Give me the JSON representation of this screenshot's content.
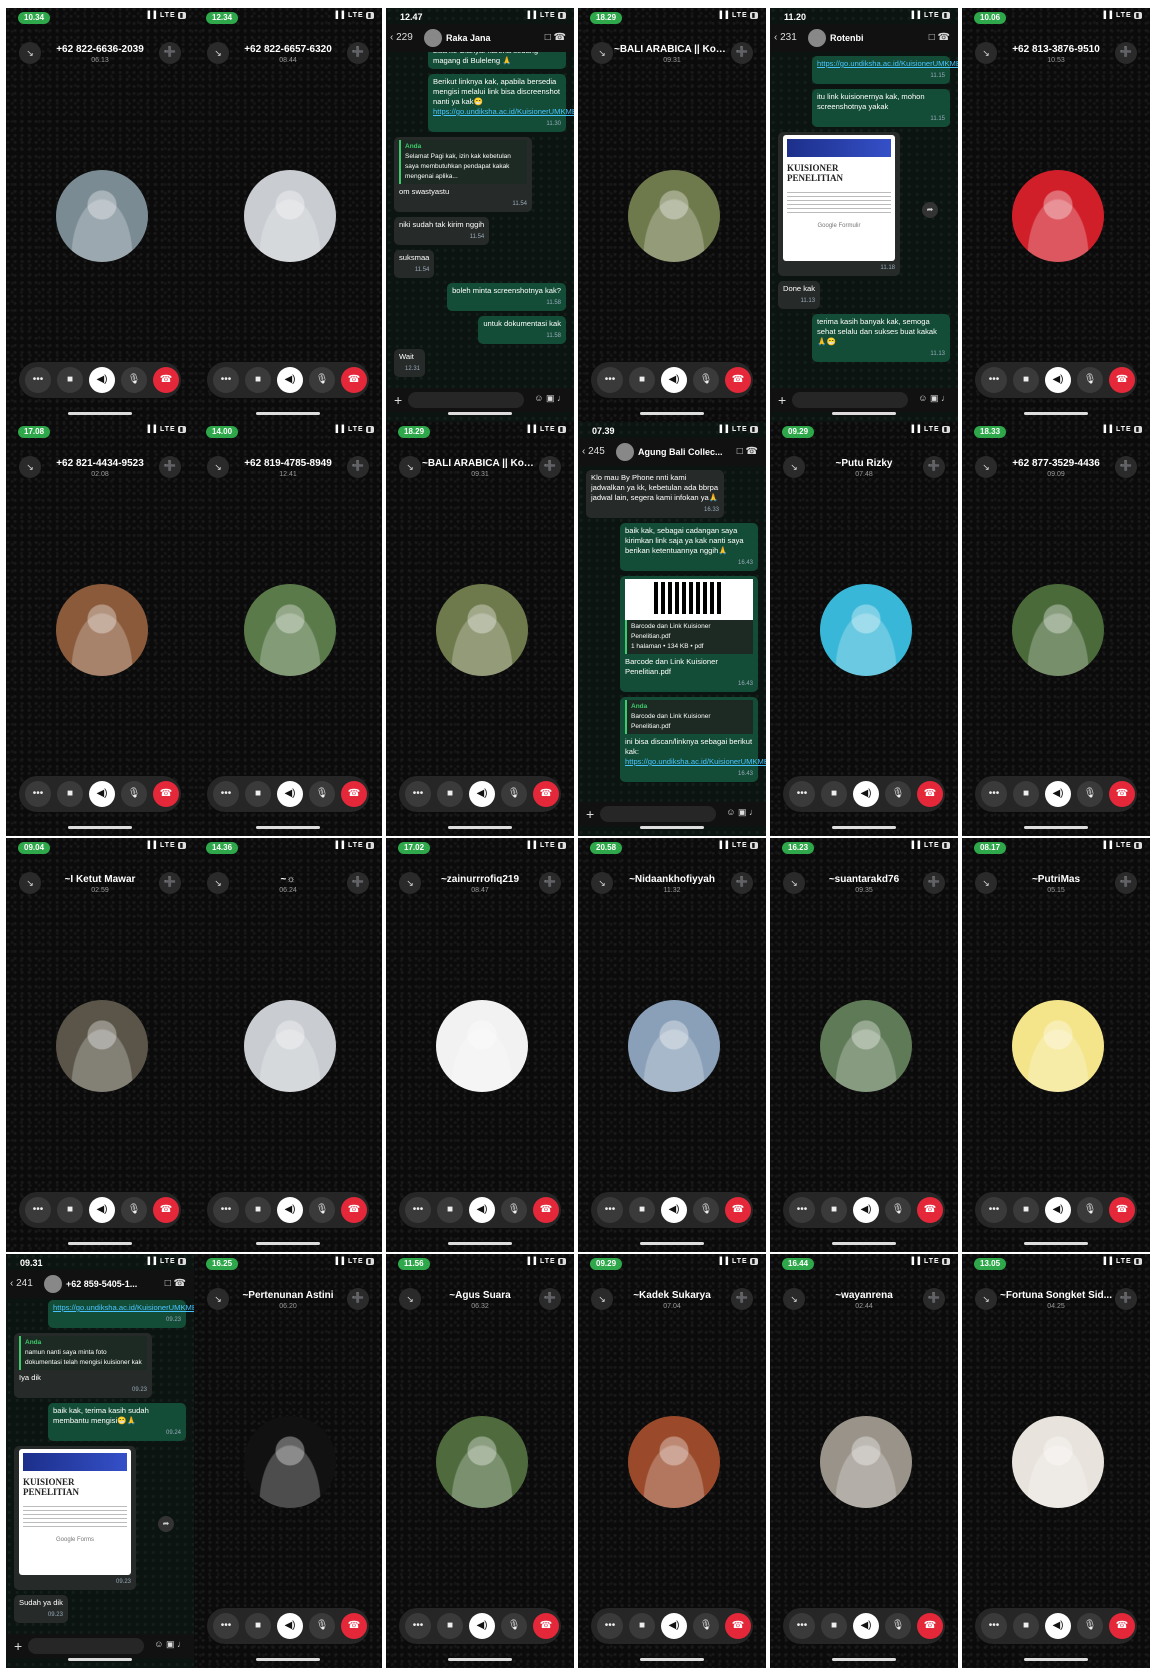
{
  "controls": {
    "more": "•••",
    "video": "■",
    "speaker": "◀)",
    "mute": "🎙",
    "end": "☎",
    "minimize": "↘",
    "add_person": "➕"
  },
  "calls": [
    {
      "time": "10.34",
      "name": "+62 822-6636-2039",
      "duration": "06.13",
      "avatar_color": "#7a8b94"
    },
    {
      "time": "12.34",
      "name": "+62 822-6657-6320",
      "duration": "08.44",
      "avatar_color": "#c9ccd1"
    },
    {
      "time": "18.29",
      "name": "~BALI ARABICA || Kopi...",
      "duration": "09.31",
      "avatar_color": "#6f7a4c"
    },
    {
      "time": "10.06",
      "name": "+62 813-3876-9510",
      "duration": "10.53",
      "avatar_color": "#d11f2a"
    },
    {
      "time": "17.08",
      "name": "+62 821-4434-9523",
      "duration": "02.08",
      "avatar_color": "#8a5a3a"
    },
    {
      "time": "14.00",
      "name": "+62 819-4785-8949",
      "duration": "12.41",
      "avatar_color": "#5a7a4a"
    },
    {
      "time": "18.29",
      "name": "~BALI ARABICA || Kopi...",
      "duration": "09.31",
      "avatar_color": "#6f7a4c"
    },
    {
      "time": "09.29",
      "name": "~Putu Rizky",
      "duration": "07.48",
      "avatar_color": "#39b7d8"
    },
    {
      "time": "18.33",
      "name": "+62 877-3529-4436",
      "duration": "09.09",
      "avatar_color": "#4a6a3a"
    },
    {
      "time": "09.04",
      "name": "~I Ketut Mawar",
      "duration": "02.59",
      "avatar_color": "#5a5548"
    },
    {
      "time": "14.36",
      "name": "~☼",
      "duration": "06.24",
      "avatar_color": "#c9ccd1"
    },
    {
      "time": "17.02",
      "name": "~zainurrrofiq219",
      "duration": "08.47",
      "avatar_color": "#f2f2f2"
    },
    {
      "time": "20.58",
      "name": "~Nidaankhofiyyah",
      "duration": "11.32",
      "avatar_color": "#8aa0b8"
    },
    {
      "time": "16.23",
      "name": "~suantarakd76",
      "duration": "09.35",
      "avatar_color": "#5f7a56"
    },
    {
      "time": "08.17",
      "name": "~PutriMas",
      "duration": "05.15",
      "avatar_color": "#f4e58a"
    },
    {
      "time": "16.25",
      "name": "~Pertenunan Astini",
      "duration": "06.20",
      "avatar_color": "#111111"
    },
    {
      "time": "11.56",
      "name": "~Agus Suara",
      "duration": "06.32",
      "avatar_color": "#4f6b3e"
    },
    {
      "time": "09.29",
      "name": "~Kadek Sukarya",
      "duration": "07.04",
      "avatar_color": "#9a4a2a"
    },
    {
      "time": "16.44",
      "name": "~wayanrena",
      "duration": "02.44",
      "avatar_color": "#9a938a"
    },
    {
      "time": "13.05",
      "name": "~Fortuna Songket Sid...",
      "duration": "04.25",
      "avatar_color": "#e8e3dc"
    }
  ],
  "chats": [
    {
      "time": "12.47",
      "back": "229",
      "contact": "Raka Jana",
      "messages": [
        {
          "dir": "out",
          "text": "Sl APIK, jika tidak memungkinkan melalui telepon, kakak bisa mengisi sendiri melalui link kuisioner yang saya sediakan, kebetulan saya belum bisa ke Gianyar karena sedang magang di Buleleng 🙏",
          "time": ""
        },
        {
          "dir": "out",
          "text": "Berikut linknya kak, apabila bersedia mengisi melalui link bisa discreenshot nanti ya kak😁",
          "link": "https://go.undiksha.ac.id/KuisionerUMKMBI2024",
          "time": "11.30"
        },
        {
          "dir": "in",
          "quote_name": "Anda",
          "quote_text": "Selamat Pagi kak, izin kak kebetulan saya membutuhkan pendapat kakak mengenai aplika...",
          "text": "om swastyastu",
          "time": "11.54"
        },
        {
          "dir": "in",
          "text": "niki sudah tak kirim nggih",
          "time": "11.54"
        },
        {
          "dir": "in",
          "text": "suksmaa",
          "time": "11.54"
        },
        {
          "dir": "out",
          "text": "boleh minta screenshotnya kak?",
          "time": "11.58"
        },
        {
          "dir": "out",
          "text": "untuk dokumentasi kak",
          "time": "11.58"
        },
        {
          "dir": "in",
          "text": "Wait",
          "time": "12.31"
        }
      ]
    },
    {
      "time": "11.20",
      "back": "231",
      "contact": "Rotenbi",
      "messages": [
        {
          "dir": "out",
          "link": "https://go.undiksha.ac.id/KuisionerUMKMBI2024",
          "text": "",
          "time": "11.15"
        },
        {
          "dir": "out",
          "text": "itu link kuisionernya kak, mohon screenshotnya yakak",
          "time": "11.15"
        },
        {
          "dir": "in",
          "form_title": "KUISIONER PENELITIAN",
          "form_footer": "Google Formulir",
          "text": "",
          "time": "11.18"
        },
        {
          "dir": "in",
          "text": "Done kak",
          "time": "11.13"
        },
        {
          "dir": "out",
          "text": "terima kasih banyak kak, semoga sehat selalu dan sukses buat kakak 🙏😁",
          "time": "11.13"
        }
      ]
    },
    {
      "time": "07.39",
      "back": "245",
      "contact": "Agung Bali Collec...",
      "messages": [
        {
          "dir": "in",
          "text": "Klo mau By Phone nnti kami jadwalkan ya kk, kebetulan ada bbrpa jadwal lain, segera kami infokan ya🙏",
          "time": "16.33"
        },
        {
          "dir": "out",
          "text": "baik kak, sebagai cadangan saya kirimkan link saja ya kak nanti saya berikan ketentuannya nggih🙏",
          "time": "16.43"
        },
        {
          "dir": "out",
          "file_name": "Barcode dan Link Kuisioner Penelitian.pdf",
          "file_meta": "1 halaman • 134 KB • pdf",
          "text": "Barcode dan Link Kuisioner Penelitian.pdf",
          "time": "16.43"
        },
        {
          "dir": "out",
          "quote_name": "Anda",
          "quote_text": "Barcode dan Link Kuisioner Penelitian.pdf",
          "text": "ini bisa discan/linknya sebagai berikut kak:",
          "link": "https://go.undiksha.ac.id/KuisionerUMKMBI2024",
          "time": "16.43"
        }
      ]
    },
    {
      "time": "09.31",
      "back": "241",
      "contact": "+62 859-5405-1...",
      "messages": [
        {
          "dir": "out",
          "link": "https://go.undiksha.ac.id/KuisionerUMKMBI2024",
          "text": "",
          "time": "09.23"
        },
        {
          "dir": "in",
          "quote_name": "Anda",
          "quote_text": "namun nanti saya minta foto dokumentasi telah mengisi kuisioner kak",
          "text": "Iya dik",
          "time": "09.23"
        },
        {
          "dir": "out",
          "text": "baik kak, terima kasih sudah membantu mengisi😁🙏",
          "time": "09.24"
        },
        {
          "dir": "in",
          "form_title": "KUISIONER PENELITIAN",
          "form_footer": "Google Forms",
          "text": "",
          "time": "09.23"
        },
        {
          "dir": "in",
          "text": "Sudah ya dik",
          "time": "09.23"
        }
      ]
    }
  ]
}
